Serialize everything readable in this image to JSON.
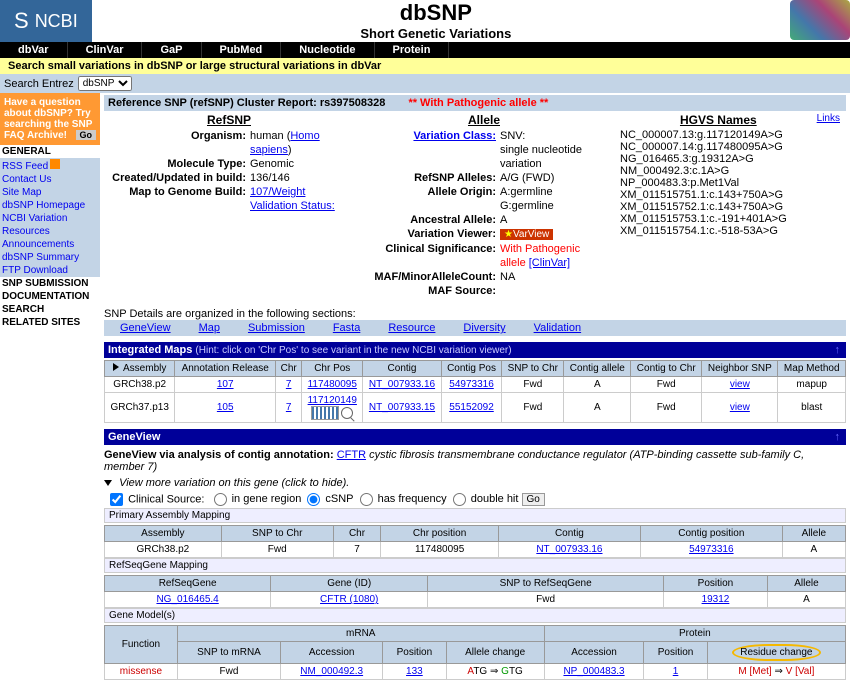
{
  "header": {
    "ncbi": "NCBI",
    "title": "dbSNP",
    "subtitle": "Short Genetic Variations"
  },
  "nav_tabs": [
    "dbVar",
    "ClinVar",
    "GaP",
    "PubMed",
    "Nucleotide",
    "Protein"
  ],
  "search_strip": "Search small variations in dbSNP or large structural variations in dbVar",
  "search_entrez": {
    "label": "Search Entrez",
    "select": "dbSNP"
  },
  "sidebar": {
    "faq": {
      "line1": "Have a question about dbSNP? Try searching the SNP FAQ Archive!",
      "go": "Go"
    },
    "sections": [
      {
        "head": "GENERAL",
        "items": [
          "RSS Feed",
          "Contact Us",
          "Site Map",
          "dbSNP Homepage",
          "NCBI Variation",
          "Resources",
          "Announcements",
          "dbSNP Summary",
          "FTP Download"
        ]
      },
      {
        "head": "SNP SUBMISSION",
        "items": []
      },
      {
        "head": "DOCUMENTATION",
        "items": []
      },
      {
        "head": "SEARCH",
        "items": []
      },
      {
        "head": "RELATED SITES",
        "items": []
      }
    ]
  },
  "report": {
    "title": "Reference SNP (refSNP) Cluster Report: rs397508328",
    "pathogenic": "** With Pathogenic allele **",
    "links": "Links",
    "cols": {
      "refsnp": {
        "title": "RefSNP",
        "rows": [
          {
            "k": "Organism:",
            "v": "human (",
            "link": "Homo sapiens",
            "after": ")"
          },
          {
            "k": "Molecule Type:",
            "v": "Genomic"
          },
          {
            "k": "Created/Updated in build:",
            "v": "136/146"
          },
          {
            "k": "Map to Genome Build:",
            "link": "107/Weight"
          },
          {
            "k": "",
            "link": "Validation Status:"
          }
        ]
      },
      "allele": {
        "title": "Allele",
        "rows": [
          {
            "klink": "Variation Class:",
            "v": "SNV:\nsingle nucleotide variation"
          },
          {
            "k": "RefSNP Alleles:",
            "v": "A/G (FWD)"
          },
          {
            "k": "Allele Origin:",
            "v": "A:germline\nG:germline"
          },
          {
            "k": "Ancestral Allele:",
            "v": "A"
          },
          {
            "k": "Variation Viewer:",
            "badge": "VarView"
          },
          {
            "k": "Clinical Significance:",
            "v_red": "With Pathogenic allele",
            "link_after": "[ClinVar]"
          },
          {
            "k": "MAF/MinorAlleleCount:",
            "v": "NA"
          },
          {
            "k": "MAF Source:",
            "v": ""
          }
        ]
      },
      "hgvs": {
        "title": "HGVS Names",
        "items": [
          "NC_000007.13:g.117120149A>G",
          "NC_000007.14:g.117480095A>G",
          "NG_016465.3:g.19312A>G",
          "NM_000492.3:c.1A>G",
          "NP_000483.3:p.Met1Val",
          "XM_011515751.1:c.143+750A>G",
          "XM_011515752.1:c.143+750A>G",
          "XM_011515753.1:c.-191+401A>G",
          "XM_011515754.1:c.-518-53A>G"
        ]
      }
    }
  },
  "details_intro": "SNP Details are organized in the following sections:",
  "section_links": [
    "GeneView",
    "Map",
    "Submission",
    "Fasta",
    "Resource",
    "Diversity",
    "Validation"
  ],
  "integrated_maps": {
    "title": "Integrated Maps",
    "hint": "(Hint: click on 'Chr Pos' to see variant in the new NCBI variation viewer)",
    "headers": [
      "Assembly",
      "Annotation Release",
      "Chr",
      "Chr Pos",
      "Contig",
      "Contig Pos",
      "SNP to Chr",
      "Contig allele",
      "Contig to Chr",
      "Neighbor SNP",
      "Map Method"
    ],
    "rows": [
      {
        "assembly": "GRCh38.p2",
        "anno": "107",
        "chr": "7",
        "chrpos": "117480095",
        "contig": "NT_007933.16",
        "contigpos": "54973316",
        "s2c": "Fwd",
        "ca": "A",
        "c2c": "Fwd",
        "neighbor": "view",
        "method": "mapup"
      },
      {
        "assembly": "GRCh37.p13",
        "anno": "105",
        "chr": "7",
        "chrpos": "117120149",
        "contig": "NT_007933.15",
        "contigpos": "55152092",
        "s2c": "Fwd",
        "ca": "A",
        "c2c": "Fwd",
        "neighbor": "view",
        "method": "blast",
        "thumb": true
      }
    ]
  },
  "geneview": {
    "title": "GeneView",
    "desc_pre": "GeneView via analysis of contig annotation: ",
    "gene_link": "CFTR",
    "desc_post": " cystic fibrosis transmembrane conductance regulator (ATP-binding cassette sub-family C, member 7)",
    "view_more": "View more variation on this gene (click to hide).",
    "clinical_label": "Clinical Source:",
    "radios": [
      "in gene region",
      "cSNP",
      "has frequency",
      "double hit"
    ],
    "go": "Go",
    "primary_head": "Primary Assembly Mapping",
    "primary_headers": [
      "Assembly",
      "SNP to Chr",
      "Chr",
      "Chr position",
      "Contig",
      "Contig position",
      "Allele"
    ],
    "primary_row": {
      "assembly": "GRCh38.p2",
      "s2c": "Fwd",
      "chr": "7",
      "chrpos": "117480095",
      "contig": "NT_007933.16",
      "contigpos": "54973316",
      "allele": "A"
    },
    "refseq_head": "RefSeqGene Mapping",
    "refseq_headers": [
      "RefSeqGene",
      "Gene (ID)",
      "SNP to RefSeqGene",
      "Position",
      "Allele"
    ],
    "refseq_row": {
      "rsg": "NG_016465.4",
      "gene": "CFTR (1080)",
      "snp2rsg": "Fwd",
      "pos": "19312",
      "allele": "A"
    },
    "models_head": "Gene Model(s)",
    "models_top_headers": {
      "mrna": "mRNA",
      "protein": "Protein"
    },
    "models_headers": [
      "Function",
      "SNP to mRNA",
      "Accession",
      "Position",
      "Allele change",
      "Accession",
      "Position",
      "Residue change"
    ],
    "models_row": {
      "func": "missense",
      "s2m": "Fwd",
      "maccn": "NM_000492.3",
      "mpos": "133",
      "allele_from": "ATG",
      "allele_to": "GTG",
      "paccn": "NP_000483.3",
      "ppos": "1",
      "res_from": "M [Met]",
      "res_to": "V [Val]"
    }
  }
}
